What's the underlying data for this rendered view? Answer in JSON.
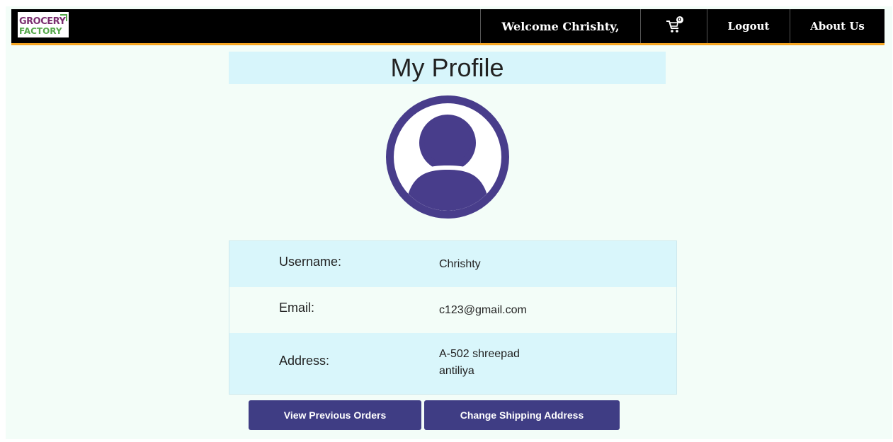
{
  "brand": {
    "logo_line1": "GROCERY",
    "logo_line2": "FACTORY",
    "primary_color": "#7a2e6f",
    "secondary_color": "#55a84a"
  },
  "navbar": {
    "welcome": "Welcome Chrishty,",
    "cart_icon": "cart-icon",
    "cart_count": "0",
    "logout": "Logout",
    "about": "About Us",
    "accent_color": "#f5a623"
  },
  "profile": {
    "title": "My Profile",
    "avatar_icon": "user-avatar-icon",
    "avatar_color": "#483d8b",
    "fields": {
      "username_label": "Username:",
      "username_value": "Chrishty",
      "email_label": "Email:",
      "email_value": "c123@gmail.com",
      "address_label": "Address:",
      "address_line1": "A-502 shreepad",
      "address_line2": "antiliya"
    }
  },
  "actions": {
    "view_orders": "View Previous Orders",
    "change_address": "Change Shipping Address",
    "button_color": "#3f3d84"
  }
}
